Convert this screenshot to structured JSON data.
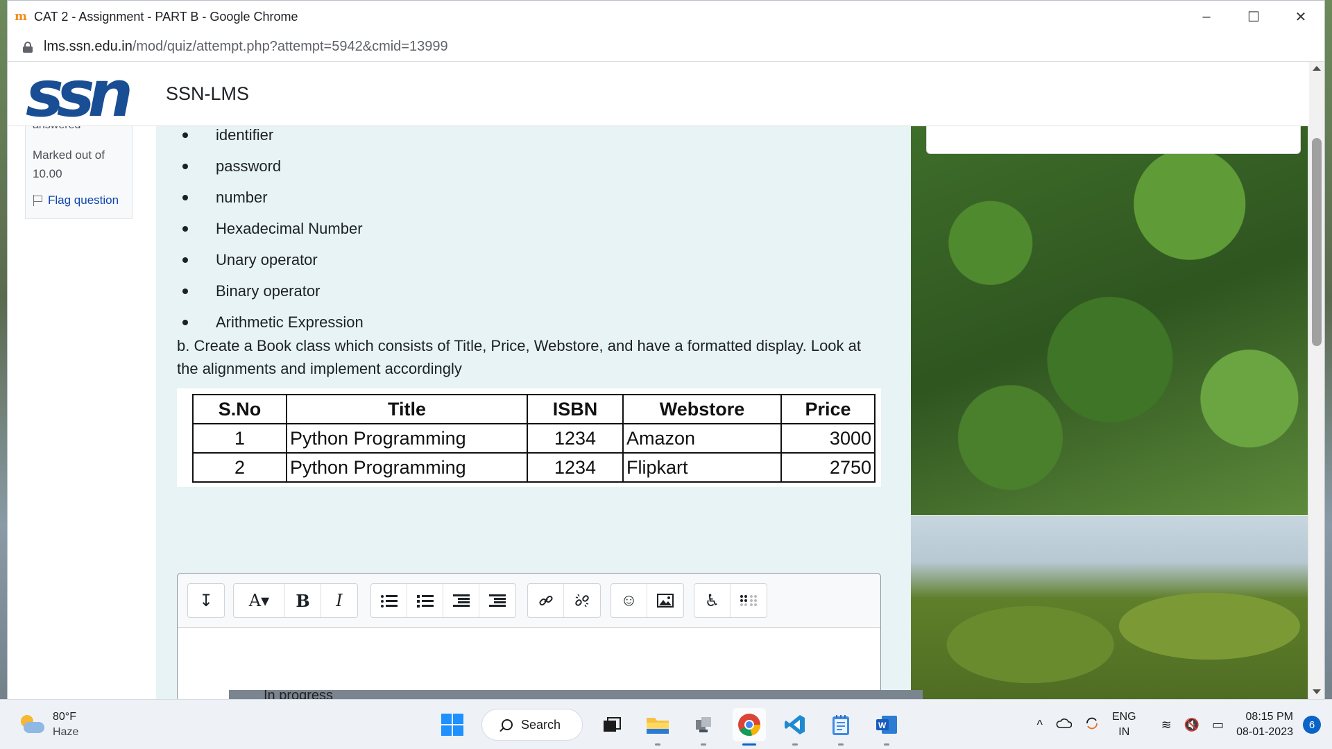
{
  "window": {
    "title": "CAT 2 - Assignment - PART B - Google Chrome",
    "favicon_glyph": "m",
    "url_host": "lms.ssn.edu.in",
    "url_path": "/mod/quiz/attempt.php?attempt=5942&cmid=13999",
    "controls": {
      "minimize": "–",
      "maximize": "☐",
      "close": "✕"
    }
  },
  "navbar": {
    "logo_text": "ssn",
    "site_name": "SSN-LMS"
  },
  "question_info": {
    "state": "answered",
    "grade": "Marked out of 10.00",
    "flag": "Flag question"
  },
  "question": {
    "bullets": [
      "identifier",
      "password",
      "number",
      "Hexadecimal Number",
      "Unary operator",
      "Binary operator",
      "Arithmetic Expression"
    ],
    "task_text": "b. Create a Book class which consists of Title, Price, Webstore, and have a formatted display. Look at the alignments and implement accordingly",
    "table": {
      "headers": [
        "S.No",
        "Title",
        "ISBN",
        "Webstore",
        "Price"
      ],
      "rows": [
        [
          "1",
          "Python Programming",
          "1234",
          "Amazon",
          "3000"
        ],
        [
          "2",
          "Python Programming",
          "1234",
          "Flipkart",
          "2750"
        ]
      ]
    }
  },
  "editor_toolbar": {
    "expand": "↧",
    "font": "A▾",
    "bold": "B",
    "italic": "I",
    "emoji": "☺",
    "accessibility": "♿"
  },
  "footer_peek": "In progress",
  "taskbar": {
    "weather_temp": "80°F",
    "weather_cond": "Haze",
    "search_label": "Search",
    "lang_1": "ENG",
    "lang_2": "IN",
    "time": "08:15 PM",
    "date": "08-01-2023",
    "notifications": "6",
    "tray_glyphs": {
      "chevron": "^",
      "wifi": "≋",
      "sound": "🔇",
      "battery": "▭"
    }
  },
  "colors": {
    "accent_blue": "#0f47ad",
    "logo_blue": "#1a4e94",
    "question_bg": "#e7f3f5"
  }
}
